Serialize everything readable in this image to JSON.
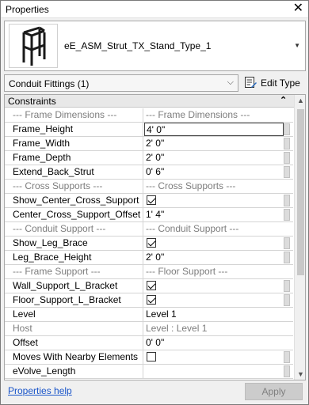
{
  "window": {
    "title": "Properties",
    "close_glyph": "✕"
  },
  "type_selector": {
    "name": "eE_ASM_Strut_TX_Stand_Type_1",
    "thumbnail_icon": "strut-stand-thumbnail",
    "dropdown_glyph": "▼"
  },
  "filter": {
    "selected": "Conduit Fittings (1)",
    "chevron_glyph": "⌵",
    "edit_type_label": "Edit Type",
    "edit_type_icon": "edit-type-icon"
  },
  "grid": {
    "group_label": "Constraints",
    "collapse_glyph": "⌃",
    "rows": [
      {
        "kind": "section",
        "name": "---   Frame Dimensions   ---",
        "value": "---   Frame Dimensions   ---"
      },
      {
        "kind": "text",
        "name": "Frame_Height",
        "value": "4'  0\"",
        "active": true
      },
      {
        "kind": "text",
        "name": "Frame_Width",
        "value": "2'  0\""
      },
      {
        "kind": "text",
        "name": "Frame_Depth",
        "value": "2'  0\""
      },
      {
        "kind": "text",
        "name": "Extend_Back_Strut",
        "value": "0'  6\""
      },
      {
        "kind": "section",
        "name": "---   Cross Supports   ---",
        "value": "---   Cross Supports   ---"
      },
      {
        "kind": "check",
        "name": "Show_Center_Cross_Support",
        "checked": true
      },
      {
        "kind": "text",
        "name": "Center_Cross_Support_Offset",
        "value": "1'  4\""
      },
      {
        "kind": "section",
        "name": "---   Conduit Support   ---",
        "value": "---   Conduit Support   ---"
      },
      {
        "kind": "check",
        "name": "Show_Leg_Brace",
        "checked": true
      },
      {
        "kind": "text",
        "name": "Leg_Brace_Height",
        "value": "2'  0\""
      },
      {
        "kind": "section",
        "name": "---   Frame Support   ---",
        "value": "---   Floor Support   ---"
      },
      {
        "kind": "check",
        "name": "Wall_Support_L_Bracket",
        "checked": true
      },
      {
        "kind": "check",
        "name": "Floor_Support_L_Bracket",
        "checked": true
      },
      {
        "kind": "plain",
        "name": "Level",
        "value": "Level 1"
      },
      {
        "kind": "grey",
        "name": "Host",
        "value": "Level : Level 1"
      },
      {
        "kind": "plain",
        "name": "Offset",
        "value": "0'  0\""
      },
      {
        "kind": "check",
        "name": "Moves With Nearby Elements",
        "checked": false
      },
      {
        "kind": "text",
        "name": "eVolve_Length",
        "value": ""
      }
    ]
  },
  "footer": {
    "help_link": "Properties help",
    "apply_label": "Apply"
  }
}
